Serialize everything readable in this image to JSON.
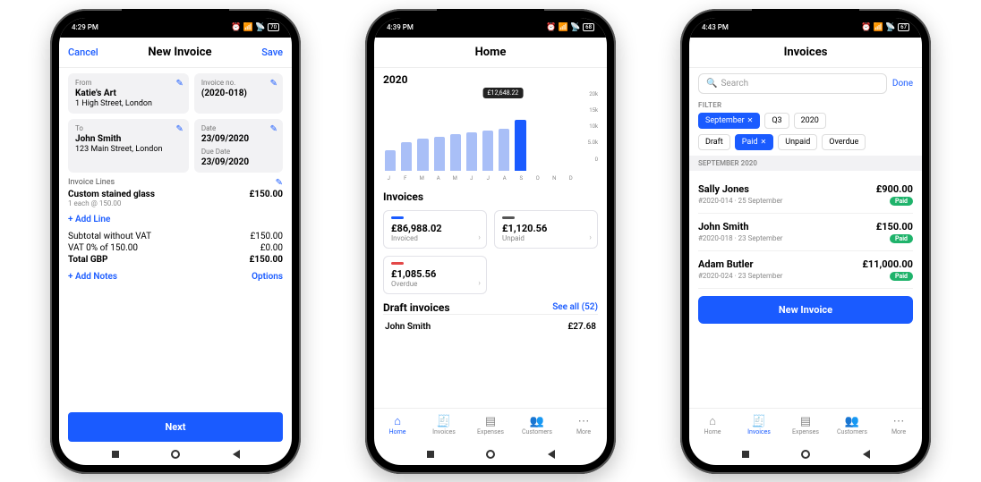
{
  "phone1": {
    "status_time": "4:29 PM",
    "status_battery": "70",
    "nav_cancel": "Cancel",
    "nav_title": "New Invoice",
    "nav_save": "Save",
    "from_lbl": "From",
    "from_name": "Katie's Art",
    "from_addr": "1 High Street, London",
    "invno_lbl": "Invoice no.",
    "invno_val": "(2020-018)",
    "to_lbl": "To",
    "to_name": "John Smith",
    "to_addr": "123 Main Street, London",
    "date_lbl": "Date",
    "date_val": "23/09/2020",
    "due_lbl": "Due Date",
    "due_val": "23/09/2020",
    "lines_lbl": "Invoice Lines",
    "line_name": "Custom stained glass",
    "line_qty": "1 each @ 150.00",
    "line_amount": "£150.00",
    "add_line": "+ Add Line",
    "sub_lbl": "Subtotal without VAT",
    "sub_val": "£150.00",
    "vat_lbl": "VAT 0% of 150.00",
    "vat_val": "£0.00",
    "tot_lbl": "Total GBP",
    "tot_val": "£150.00",
    "add_notes": "+ Add Notes",
    "options": "Options",
    "next": "Next"
  },
  "phone2": {
    "status_time": "4:39 PM",
    "status_battery": "68",
    "title": "Home",
    "year": "2020",
    "tooltip": "£12,648.22",
    "yticks": [
      "20k",
      "15k",
      "10k",
      "5.0k",
      "0"
    ],
    "months": [
      "J",
      "F",
      "M",
      "A",
      "M",
      "J",
      "J",
      "A",
      "S",
      "O",
      "N",
      "D"
    ],
    "h_invoices": "Invoices",
    "stat_invoiced_amt": "£86,988.02",
    "stat_invoiced_lbl": "Invoiced",
    "stat_unpaid_amt": "£1,120.56",
    "stat_unpaid_lbl": "Unpaid",
    "stat_overdue_amt": "£1,085.56",
    "stat_overdue_lbl": "Overdue",
    "h_draft": "Draft invoices",
    "seeall": "See all (52)",
    "draft_name": "John Smith",
    "draft_amt": "£27.68",
    "tabs": {
      "home": "Home",
      "invoices": "Invoices",
      "expenses": "Expenses",
      "customers": "Customers",
      "more": "More"
    }
  },
  "chart_data": {
    "type": "bar",
    "title": "",
    "xlabel": "",
    "ylabel": "",
    "ylim": [
      0,
      20000
    ],
    "yticks": [
      0,
      5000,
      10000,
      15000,
      20000
    ],
    "categories": [
      "J",
      "F",
      "M",
      "A",
      "M",
      "J",
      "J",
      "A",
      "S",
      "O",
      "N",
      "D"
    ],
    "values": [
      5000,
      7000,
      8000,
      8500,
      9000,
      9500,
      10000,
      10500,
      12648.22,
      0,
      0,
      0
    ],
    "highlight_index": 8,
    "highlight_value": 12648.22,
    "annotations": [
      "£12,648.22"
    ]
  },
  "phone3": {
    "status_time": "4:43 PM",
    "status_battery": "67",
    "title": "Invoices",
    "search_ph": "Search",
    "done": "Done",
    "filter_lbl": "FILTER",
    "chips": {
      "sep": "September",
      "q3": "Q3",
      "y": "2020",
      "draft": "Draft",
      "paid": "Paid",
      "unpaid": "Unpaid",
      "overdue": "Overdue"
    },
    "group": "SEPTEMBER 2020",
    "items": [
      {
        "name": "Sally Jones",
        "amt": "£900.00",
        "meta": "#2020-014 · 25 September",
        "status": "Paid"
      },
      {
        "name": "John Smith",
        "amt": "£150.00",
        "meta": "#2020-018 · 23 September",
        "status": "Paid"
      },
      {
        "name": "Adam Butler",
        "amt": "£11,000.00",
        "meta": "#2020-024 · 23 September",
        "status": "Paid"
      }
    ],
    "new_btn": "New Invoice",
    "tabs": {
      "home": "Home",
      "invoices": "Invoices",
      "expenses": "Expenses",
      "customers": "Customers",
      "more": "More"
    }
  }
}
